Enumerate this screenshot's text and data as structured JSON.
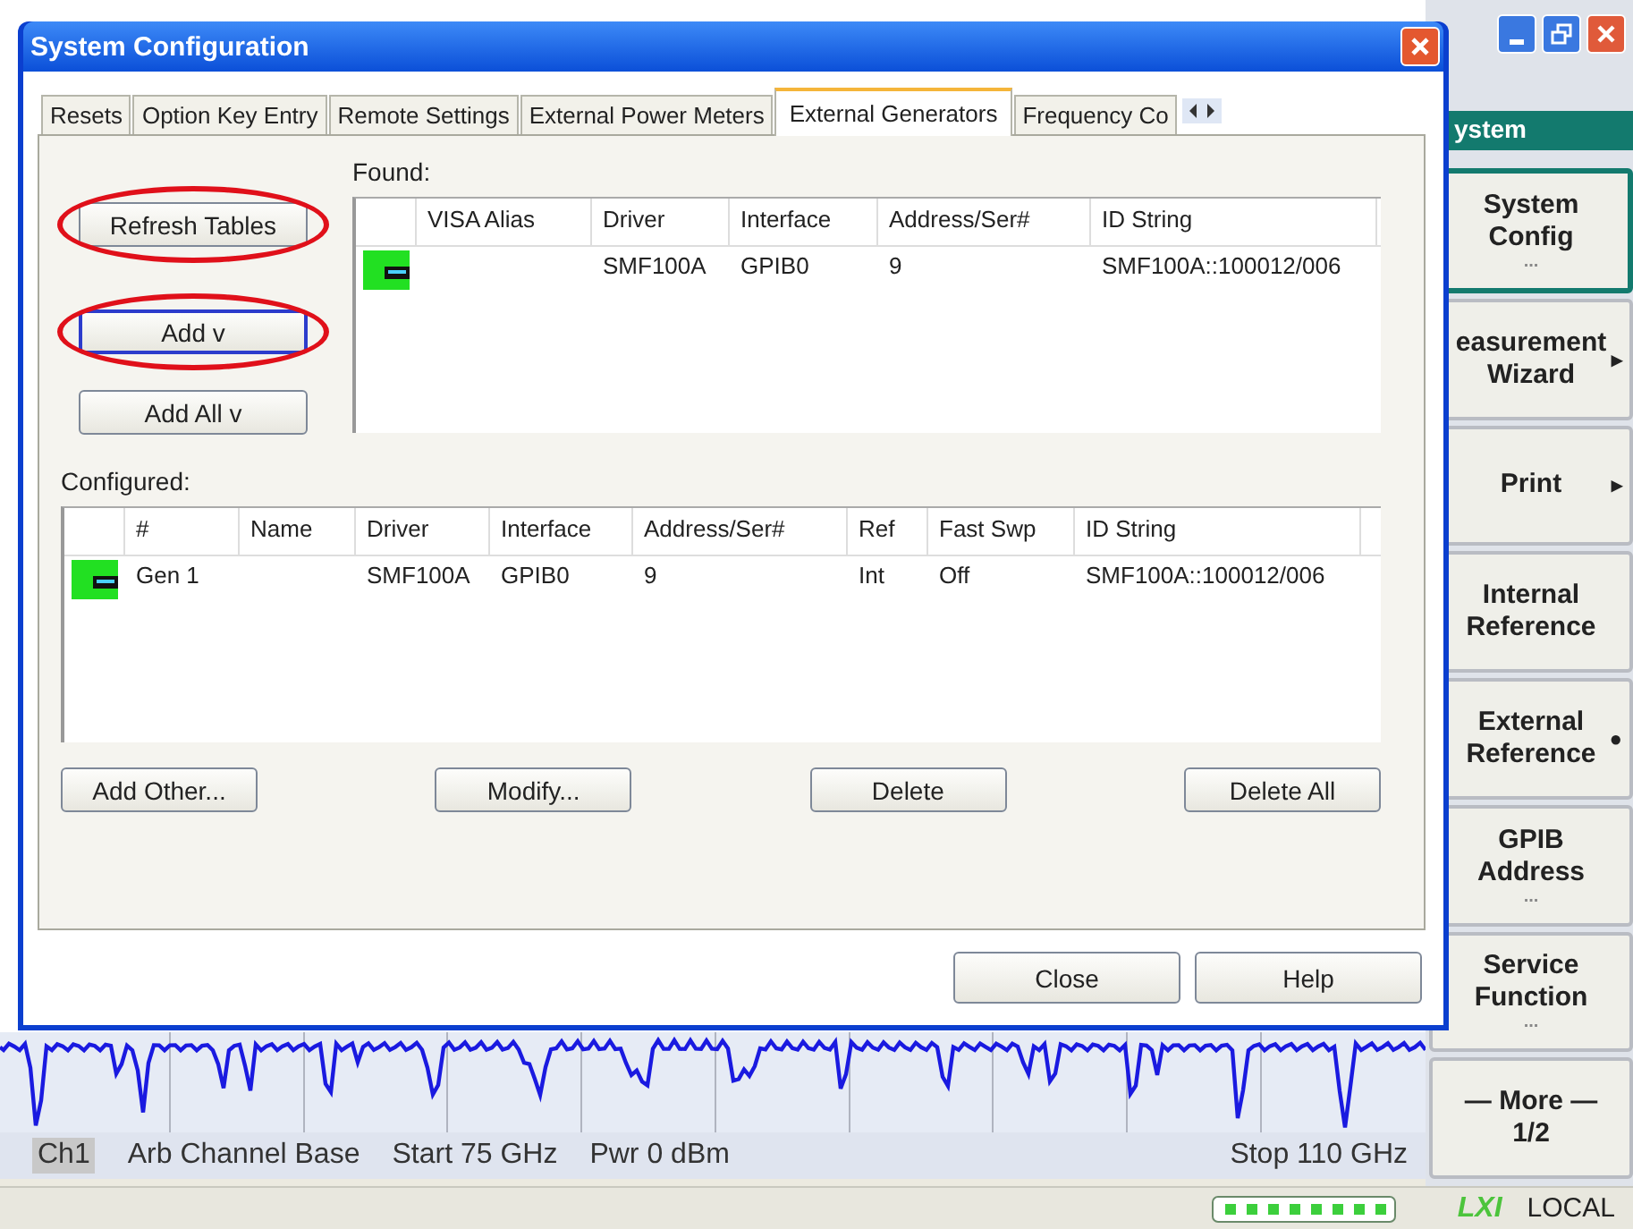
{
  "app": {
    "header": "ystem",
    "softkeys": [
      {
        "lines": [
          "System",
          "Config"
        ],
        "hint": "...",
        "selected": true
      },
      {
        "lines": [
          "easurement",
          "Wizard"
        ],
        "mark": "▸",
        "selected": false
      },
      {
        "lines": [
          "Print"
        ],
        "mark": "▸",
        "selected": false
      },
      {
        "lines": [
          "Internal",
          "Reference"
        ],
        "selected": false
      },
      {
        "lines": [
          "External",
          "Reference"
        ],
        "mark": "●",
        "selected": false
      },
      {
        "lines": [
          "GPIB",
          "Address"
        ],
        "hint": "...",
        "selected": false
      },
      {
        "lines": [
          "Service",
          "Function"
        ],
        "hint": "...",
        "selected": false
      },
      {
        "lines": [
          "— More —",
          "1/2"
        ],
        "selected": false
      }
    ],
    "status_line": {
      "channel": "Ch1",
      "items": [
        "Arb Channel Base",
        "Start  75 GHz",
        "Pwr  0 dBm"
      ],
      "stop": "Stop  110 GHz"
    },
    "bottom_bar": {
      "logo": "LXI",
      "mode": "LOCAL"
    }
  },
  "dialog": {
    "title": "System Configuration",
    "tabs": [
      {
        "label": "Resets",
        "selected": false
      },
      {
        "label": "Option Key Entry",
        "selected": false
      },
      {
        "label": "Remote Settings",
        "selected": false
      },
      {
        "label": "External Power Meters",
        "selected": false
      },
      {
        "label": "External Generators",
        "selected": true
      },
      {
        "label": "Frequency Co",
        "selected": false
      }
    ],
    "side_buttons": [
      {
        "label": "Refresh Tables",
        "highlighted": true,
        "focused": false
      },
      {
        "label": "Add  v",
        "highlighted": true,
        "focused": true
      },
      {
        "label": "Add All  v",
        "highlighted": false,
        "focused": false
      }
    ],
    "found": {
      "label": "Found:",
      "columns": [
        "VISA Alias",
        "Driver",
        "Interface",
        "Address/Ser#",
        "ID String"
      ],
      "rows": [
        {
          "cells": [
            null,
            "SMF100A",
            "GPIB0",
            "9",
            "SMF100A::100012/006"
          ]
        }
      ]
    },
    "configured": {
      "label": "Configured:",
      "columns": [
        "#",
        "Name",
        "Driver",
        "Interface",
        "Address/Ser#",
        "Ref",
        "Fast Swp",
        "ID String"
      ],
      "rows": [
        {
          "cells": [
            "Gen 1",
            null,
            "SMF100A",
            "GPIB0",
            "9",
            "Int",
            "Off",
            "SMF100A::100012/006"
          ]
        }
      ]
    },
    "table_buttons": [
      "Add Other...",
      "Modify...",
      "Delete",
      "Delete All"
    ],
    "footer_buttons": [
      "Close",
      "Help"
    ]
  }
}
